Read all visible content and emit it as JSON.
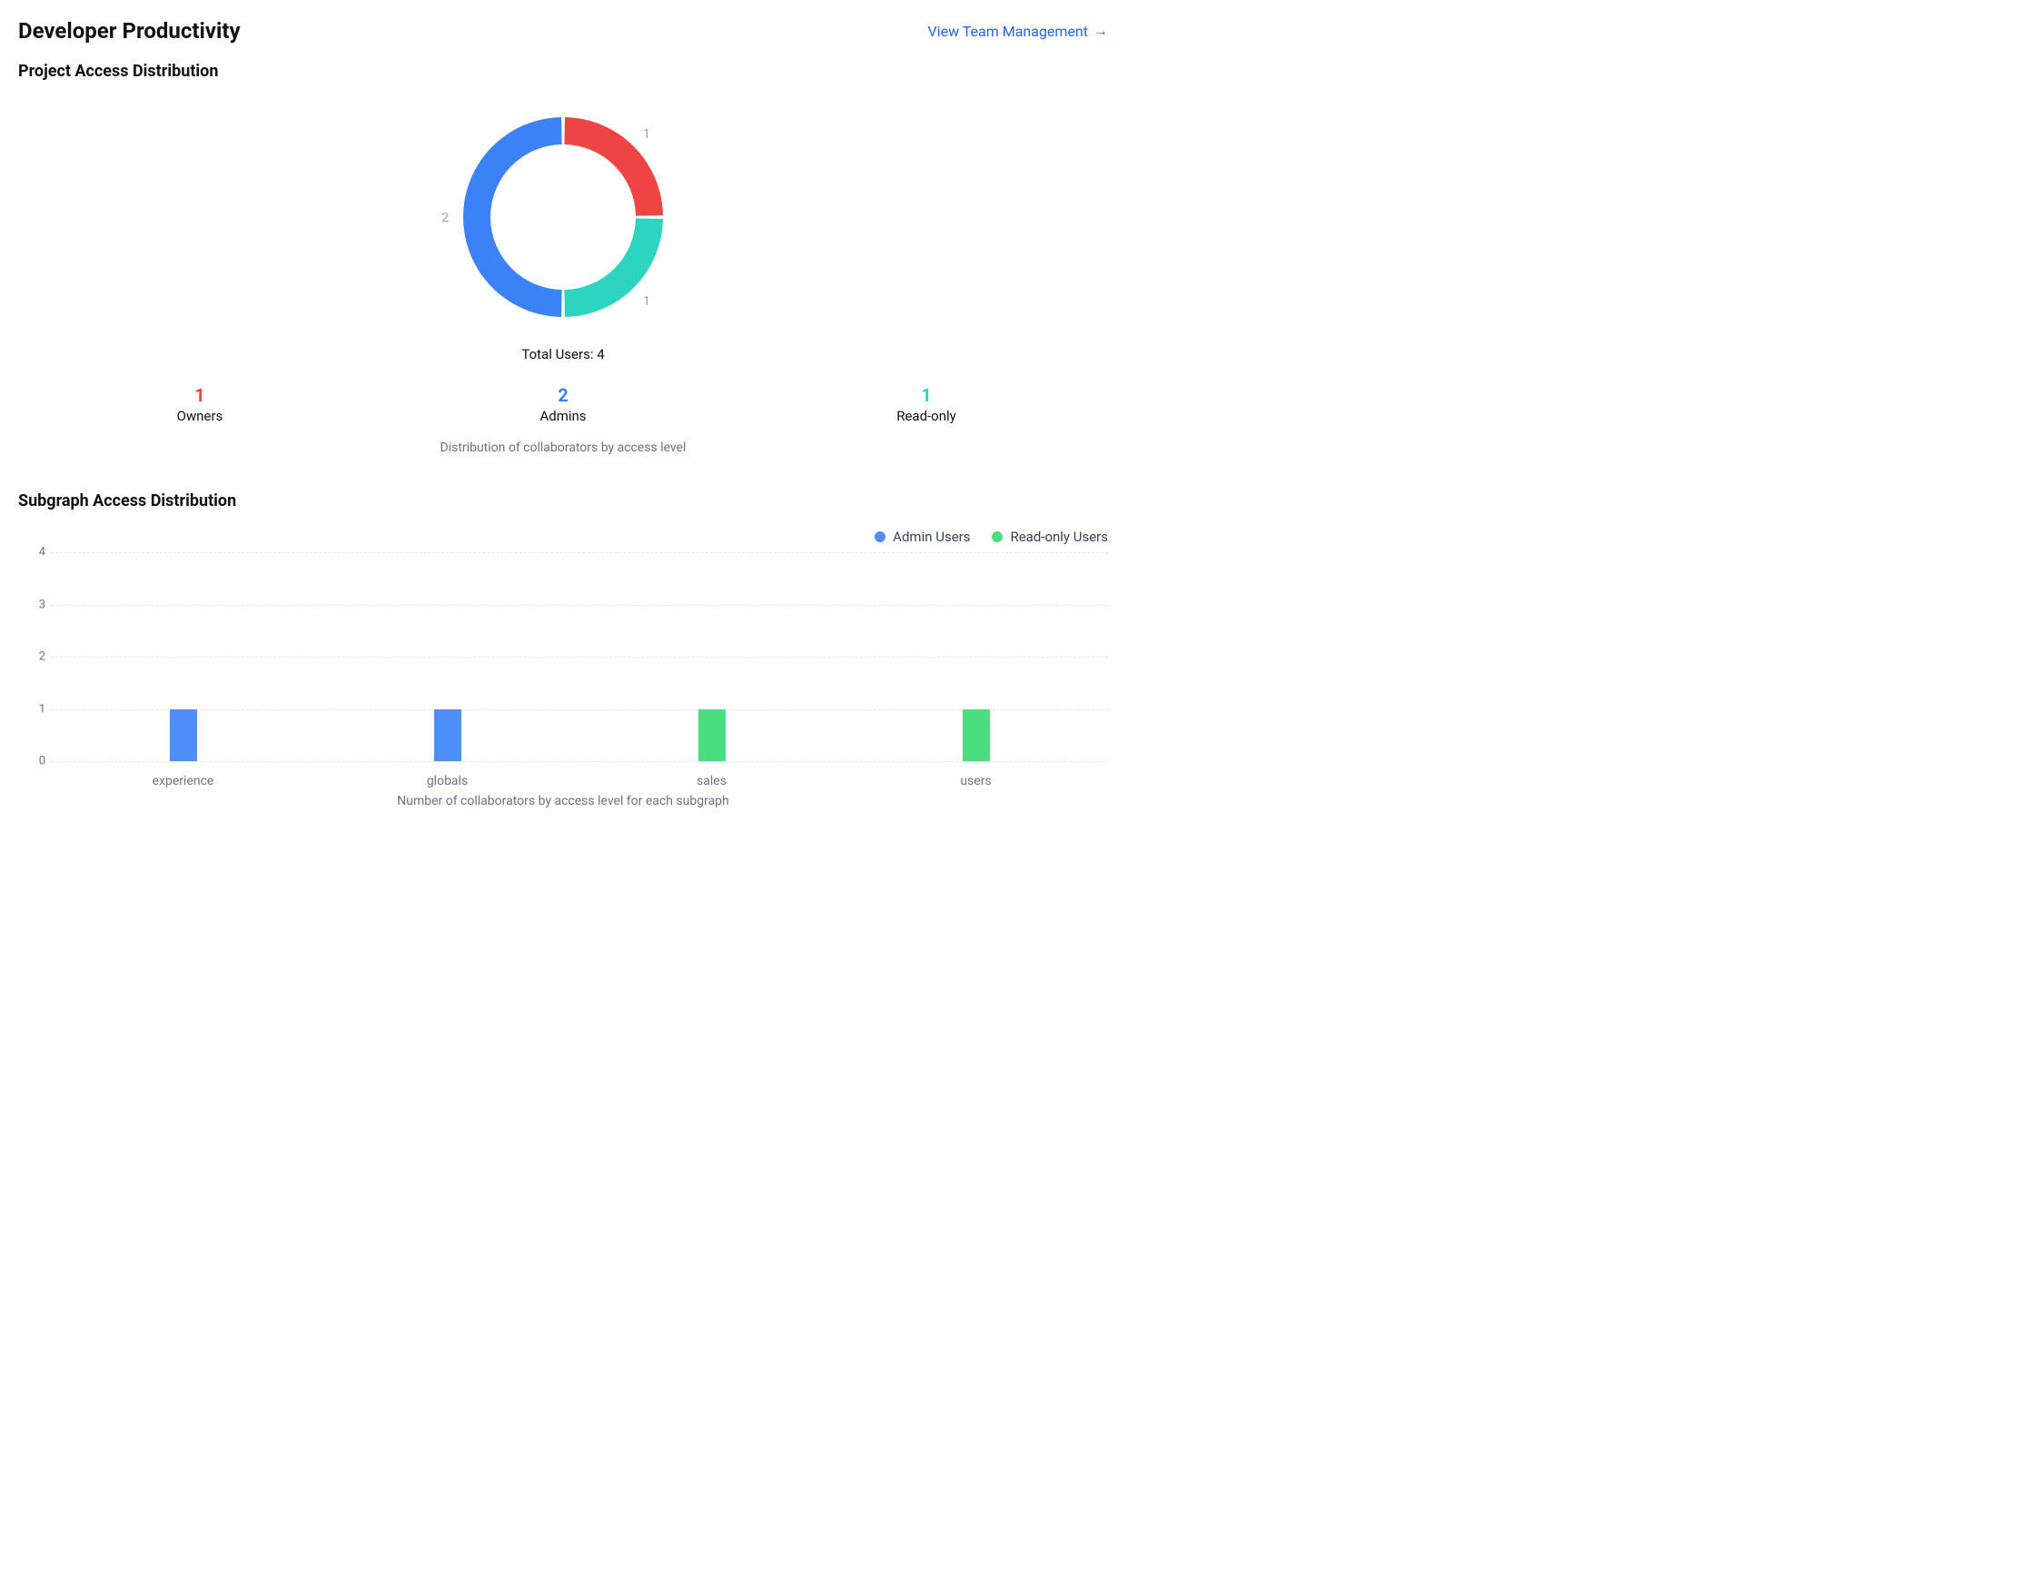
{
  "header": {
    "title": "Developer Productivity",
    "link_label": "View Team Management"
  },
  "project_access": {
    "section_title": "Project Access Distribution",
    "total_users_prefix": "Total Users: ",
    "total_users": 4,
    "caption": "Distribution of collaborators by access level",
    "stats": {
      "owners": {
        "count": 1,
        "label": "Owners",
        "color": "#ef4444"
      },
      "admins": {
        "count": 2,
        "label": "Admins",
        "color": "#3b82f6"
      },
      "readonly": {
        "count": 1,
        "label": "Read-only",
        "color": "#2dd4bf"
      }
    }
  },
  "subgraph_access": {
    "section_title": "Subgraph Access Distribution",
    "caption": "Number of collaborators by access level for each subgraph",
    "legend": {
      "admin": {
        "label": "Admin Users",
        "color": "#4f8ef7"
      },
      "readonly": {
        "label": "Read-only Users",
        "color": "#4ade80"
      }
    }
  },
  "chart_data": [
    {
      "type": "pie",
      "title": "Project Access Distribution",
      "series": [
        {
          "name": "Owners",
          "value": 1,
          "color": "#ef4444"
        },
        {
          "name": "Admins",
          "value": 2,
          "color": "#3b82f6"
        },
        {
          "name": "Read-only",
          "value": 1,
          "color": "#2dd4bf"
        }
      ],
      "total_label": "Total Users: 4"
    },
    {
      "type": "bar",
      "title": "Subgraph Access Distribution",
      "categories": [
        "experience",
        "globals",
        "sales",
        "users"
      ],
      "series": [
        {
          "name": "Admin Users",
          "color": "#4f8ef7",
          "values": [
            1,
            1,
            0,
            0
          ]
        },
        {
          "name": "Read-only Users",
          "color": "#4ade80",
          "values": [
            0,
            0,
            1,
            1
          ]
        }
      ],
      "xlabel": "",
      "ylabel": "",
      "ylim": [
        0,
        4
      ],
      "yticks": [
        0,
        1,
        2,
        3,
        4
      ]
    }
  ]
}
